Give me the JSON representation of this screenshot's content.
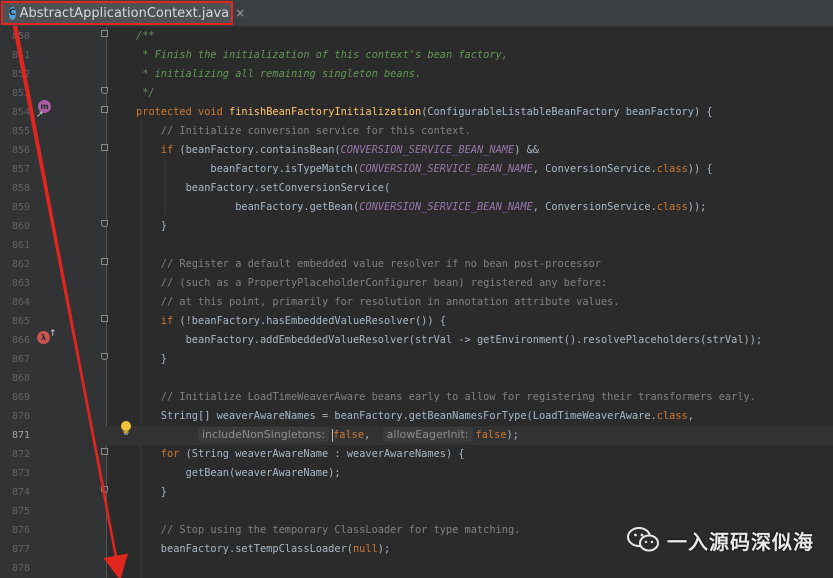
{
  "editor": {
    "tab": {
      "title": "AbstractApplicationContext.java",
      "icon": "class-icon",
      "icon_letter": "C",
      "close": "×"
    },
    "colors": {
      "background": "#2b2b2b",
      "gutter": "#313335",
      "keyword": "#cc7832",
      "method": "#ffc66d",
      "constant": "#9876aa",
      "comment": "#808080",
      "doc_comment": "#629755",
      "annotation_box": "#e0261f"
    },
    "lines": [
      {
        "num": "850",
        "tokens": [
          [
            "doc",
            "/**"
          ]
        ]
      },
      {
        "num": "851",
        "tokens": [
          [
            "doc",
            " * Finish the initialization of this context's bean factory,"
          ]
        ]
      },
      {
        "num": "852",
        "tokens": [
          [
            "doc",
            " * initializing all remaining singleton beans."
          ]
        ]
      },
      {
        "num": "853",
        "tokens": [
          [
            "doc",
            " */"
          ]
        ]
      },
      {
        "num": "854",
        "tokens": [
          [
            "kw",
            "protected void "
          ],
          [
            "fn",
            "finishBeanFactoryInitialization"
          ],
          [
            "",
            "(ConfigurableListableBeanFactory beanFactory) {"
          ]
        ]
      },
      {
        "num": "855",
        "tokens": [
          [
            "cm",
            "    // Initialize conversion service for this context."
          ]
        ]
      },
      {
        "num": "856",
        "tokens": [
          [
            "kw",
            "    if "
          ],
          [
            "",
            "(beanFactory.containsBean("
          ],
          [
            "const",
            "CONVERSION_SERVICE_BEAN_NAME"
          ],
          [
            "",
            ") &&"
          ]
        ]
      },
      {
        "num": "857",
        "tokens": [
          [
            "",
            "            beanFactory.isTypeMatch("
          ],
          [
            "const",
            "CONVERSION_SERVICE_BEAN_NAME"
          ],
          [
            "",
            ", ConversionService."
          ],
          [
            "kw",
            "class"
          ],
          [
            "",
            ")) {"
          ]
        ]
      },
      {
        "num": "858",
        "tokens": [
          [
            "",
            "        beanFactory.setConversionService("
          ]
        ]
      },
      {
        "num": "859",
        "tokens": [
          [
            "",
            "                beanFactory.getBean("
          ],
          [
            "const",
            "CONVERSION_SERVICE_BEAN_NAME"
          ],
          [
            "",
            ", ConversionService."
          ],
          [
            "kw",
            "class"
          ],
          [
            "",
            "));"
          ]
        ]
      },
      {
        "num": "860",
        "tokens": [
          [
            "",
            "    }"
          ]
        ]
      },
      {
        "num": "861",
        "tokens": []
      },
      {
        "num": "862",
        "tokens": [
          [
            "cm",
            "    // Register a default embedded value resolver if no bean post-processor"
          ]
        ]
      },
      {
        "num": "863",
        "tokens": [
          [
            "cm",
            "    // (such as a PropertyPlaceholderConfigurer bean) registered any before:"
          ]
        ]
      },
      {
        "num": "864",
        "tokens": [
          [
            "cm",
            "    // at this point, primarily for resolution in annotation attribute values."
          ]
        ]
      },
      {
        "num": "865",
        "tokens": [
          [
            "kw",
            "    if "
          ],
          [
            "",
            "(!beanFactory.hasEmbeddedValueResolver()) {"
          ]
        ]
      },
      {
        "num": "866",
        "tokens": [
          [
            "",
            "        beanFactory.addEmbeddedValueResolver(strVal -> getEnvironment().resolvePlaceholders(strVal));"
          ]
        ]
      },
      {
        "num": "867",
        "tokens": [
          [
            "",
            "    }"
          ]
        ]
      },
      {
        "num": "868",
        "tokens": []
      },
      {
        "num": "869",
        "tokens": [
          [
            "cm",
            "    // Initialize LoadTimeWeaverAware beans early to allow for registering their transformers early."
          ]
        ]
      },
      {
        "num": "870",
        "tokens": [
          [
            "",
            "    String[] weaverAwareNames = beanFactory.getBeanNamesForType(LoadTimeWeaverAware."
          ],
          [
            "kw",
            "class"
          ],
          [
            "",
            ","
          ]
        ]
      },
      {
        "num": "871",
        "current": true,
        "tokens": [
          [
            "",
            "          "
          ],
          [
            "hint",
            "includeNonSingletons:"
          ],
          [
            "caret",
            ""
          ],
          [
            "kw",
            "false"
          ],
          [
            "",
            ",  "
          ],
          [
            "hint",
            "allowEagerInit:"
          ],
          [
            "kw",
            "false"
          ],
          [
            "",
            ");"
          ]
        ]
      },
      {
        "num": "872",
        "tokens": [
          [
            "kw",
            "    for "
          ],
          [
            "",
            "(String weaverAwareName : weaverAwareNames) {"
          ]
        ]
      },
      {
        "num": "873",
        "tokens": [
          [
            "",
            "        getBean(weaverAwareName);"
          ]
        ]
      },
      {
        "num": "874",
        "tokens": [
          [
            "",
            "    }"
          ]
        ]
      },
      {
        "num": "875",
        "tokens": []
      },
      {
        "num": "876",
        "tokens": [
          [
            "cm",
            "    // Stop using the temporary ClassLoader for type matching."
          ]
        ]
      },
      {
        "num": "877",
        "tokens": [
          [
            "",
            "    beanFactory.setTempClassLoader("
          ],
          [
            "kw",
            "null"
          ],
          [
            "",
            ");"
          ]
        ]
      },
      {
        "num": "878",
        "tokens": []
      }
    ],
    "gutter_icons": {
      "override": {
        "name": "overrides-method-icon",
        "letter": "m"
      },
      "lambda": {
        "name": "lambda-icon",
        "letter": "λ"
      },
      "bulb": {
        "name": "intention-bulb-icon"
      }
    }
  },
  "watermark": {
    "text": "一入源码深似海",
    "icon": "wechat-icon"
  }
}
